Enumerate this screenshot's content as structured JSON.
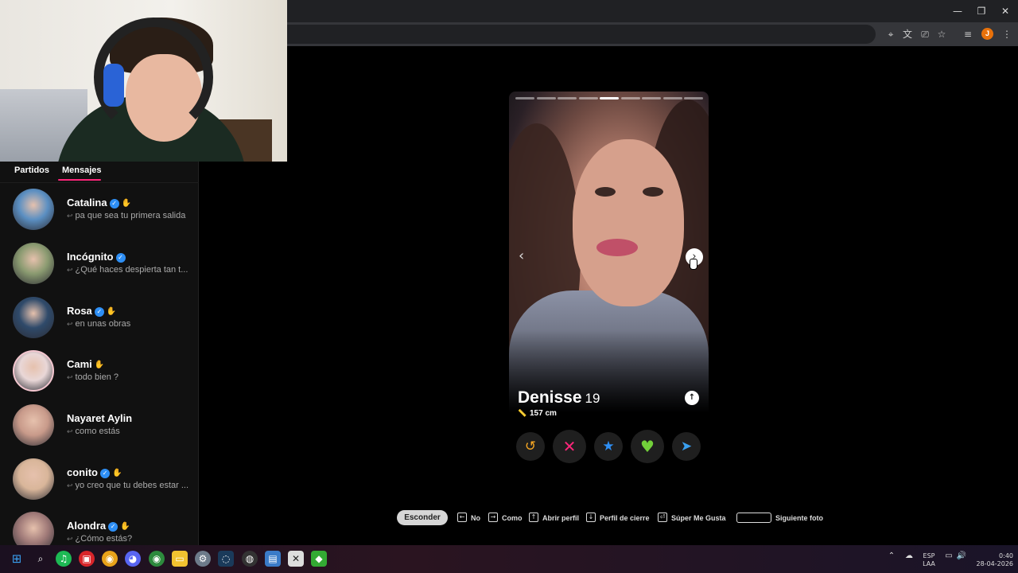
{
  "browser": {
    "window_controls": {
      "minimize": "—",
      "restore": "❐",
      "close": "✕"
    },
    "toolbar_icons": [
      "location-icon",
      "translate-icon",
      "cast-icon",
      "star-icon",
      "media-icon"
    ],
    "profile_initial": "J",
    "menu": "⋮"
  },
  "tabs": {
    "matches_label": "Partidos",
    "messages_label": "Mensajes"
  },
  "messages": [
    {
      "name": "Catalina",
      "verified": true,
      "wave": true,
      "preview": "pa que sea tu primera salida",
      "avatar_color": "#5b8fc2"
    },
    {
      "name": "Incógnito",
      "verified": true,
      "wave": false,
      "preview": "¿Qué haces despierta tan t...",
      "avatar_color": "#8a9a70"
    },
    {
      "name": "Rosa",
      "verified": true,
      "wave": true,
      "preview": "en unas obras",
      "avatar_color": "#2f4a6a"
    },
    {
      "name": "Cami",
      "verified": false,
      "wave": true,
      "preview": "todo bien ?",
      "avatar_color": "#e9d7d7"
    },
    {
      "name": "Nayaret Aylin",
      "verified": false,
      "wave": false,
      "preview": "como estás",
      "avatar_color": "#c89a8a"
    },
    {
      "name": "conito",
      "verified": true,
      "wave": true,
      "preview": "yo creo que tu debes estar ...",
      "avatar_color": "#d9b69a"
    },
    {
      "name": "Alondra",
      "verified": true,
      "wave": true,
      "preview": "¿Cómo estás?",
      "avatar_color": "#a07a78"
    }
  ],
  "profile": {
    "name": "Denisse",
    "age": "19",
    "height": "157 cm",
    "photo_count": 9,
    "active_photo": 4
  },
  "actions": {
    "rewind": "↺",
    "nope": "✕",
    "super_like": "★",
    "like": "♥",
    "boost": "➤"
  },
  "colors": {
    "rewind": "#f5a623",
    "nope": "#fd267a",
    "super_like": "#2e8ff5",
    "like": "#72d03a",
    "boost": "#3aa0f0",
    "accent": "#fd267a"
  },
  "shortcuts": {
    "hide_label": "Esconder",
    "items": [
      {
        "key": "←",
        "label": "No"
      },
      {
        "key": "→",
        "label": "Como"
      },
      {
        "key": "↑",
        "label": "Abrir perfil"
      },
      {
        "key": "↓",
        "label": "Perfil de cierre"
      },
      {
        "key": "⏎",
        "label": "Súper Me Gusta"
      },
      {
        "key": "",
        "label": "Siguiente foto"
      }
    ]
  },
  "system_tray": {
    "language": "ESP",
    "layout": "LAA",
    "time": "0:40",
    "date": "28-04-2026"
  }
}
